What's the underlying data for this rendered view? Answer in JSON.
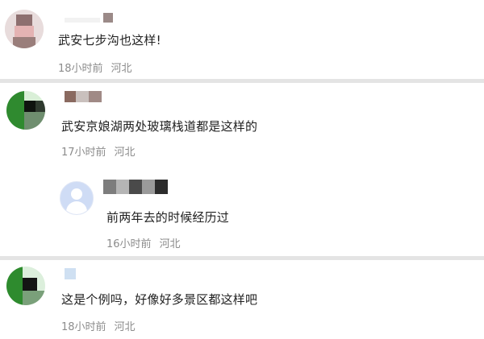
{
  "comments": [
    {
      "text": "武安七步沟也这样!",
      "time": "18小时前",
      "location": "河北",
      "avatar_colors": [
        "#e9e0e2",
        "#8d6f6f",
        "#e6b9b9",
        "#9a7e7b"
      ]
    },
    {
      "text": "武安京娘湖两处玻璃栈道都是这样的",
      "time": "17小时前",
      "location": "河北",
      "avatar_colors": [
        "#d9efd7",
        "#2f8a2f",
        "#0f130f",
        "#6f8e6f"
      ],
      "reply": {
        "text": "前两年去的时候经历过",
        "time": "16小时前",
        "location": "河北"
      }
    },
    {
      "text": "这是个例吗，好像好多景区都这样吧",
      "time": "18小时前",
      "location": "河北",
      "avatar_colors": [
        "#dcefdc",
        "#2e8b2e",
        "#141514",
        "#7aa07a"
      ]
    }
  ]
}
